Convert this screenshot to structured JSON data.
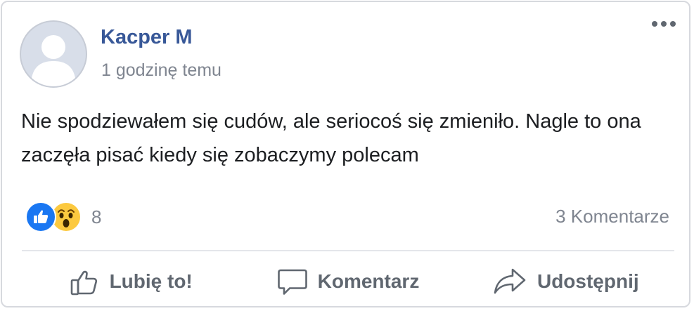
{
  "post": {
    "author": "Kacper M",
    "timestamp": "1 godzinę temu",
    "text": "Nie spodziewałem się cudów, ale seriocoś się zmieniło. Nagle to ona zaczęła pisać kiedy się zobaczymy polecam"
  },
  "reactions": {
    "types": [
      "like",
      "wow"
    ],
    "count": "8"
  },
  "comments": {
    "count_label": "3 Komentarze"
  },
  "actions": {
    "like_label": "Lubię to!",
    "comment_label": "Komentarz",
    "share_label": "Udostępnij"
  },
  "colors": {
    "author": "#385898",
    "like_reaction": "#1a77f2",
    "wow_reaction": "#fcc93f",
    "secondary_text": "#7f8590",
    "action_text": "#606770"
  },
  "icons": {
    "more": "more-options-icon",
    "avatar": "default-avatar-icon",
    "like": "thumbs-up-icon",
    "comment": "speech-bubble-icon",
    "share": "share-arrow-icon"
  }
}
